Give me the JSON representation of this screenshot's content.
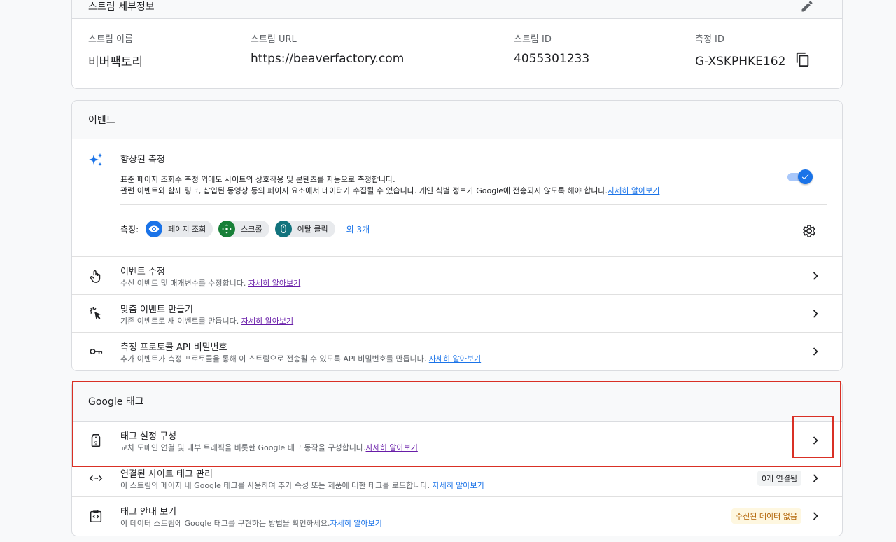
{
  "stream_card": {
    "header_title": "스트림 세부정보",
    "details": [
      {
        "label": "스트림 이름",
        "value": "비버팩토리"
      },
      {
        "label": "스트림 URL",
        "value": "https://beaverfactory.com"
      },
      {
        "label": "스트림 ID",
        "value": "4055301233"
      },
      {
        "label": "측정 ID",
        "value": "G-XSKPHKE162"
      }
    ]
  },
  "events_card": {
    "header_title": "이벤트",
    "enhanced": {
      "title": "향상된 측정",
      "desc_line1": "표준 페이지 조회수 측정 외에도 사이트의 상호작용 및 콘텐츠를 자동으로 측정합니다.",
      "desc_line2": "관련 이벤트와 함께 링크, 삽입된 동영상 등의 페이지 요소에서 데이터가 수집될 수 있습니다. 개인 식별 정보가 Google에 전송되지 않도록 해야 합니다.",
      "learn_more": "자세히 알아보기",
      "toggle_on": true,
      "measure_label": "측정:",
      "chips": [
        {
          "label": "페이지 조회",
          "icon": "eye-icon",
          "color": "#1a73e8"
        },
        {
          "label": "스크롤",
          "icon": "scroll-arrows-icon",
          "color": "#188038"
        },
        {
          "label": "이탈 클릭",
          "icon": "mouse-icon",
          "color": "#12737d"
        }
      ],
      "more": "외 3개"
    },
    "rows": [
      {
        "title": "이벤트 수정",
        "desc": "수신 이벤트 및 매개변수를 수정합니다.",
        "link": "자세히 알아보기",
        "icon": "touch-hand-icon"
      },
      {
        "title": "맞춤 이벤트 만들기",
        "desc": "기존 이벤트로 새 이벤트를 만듭니다.",
        "link": "자세히 알아보기",
        "icon": "cursor-click-icon"
      },
      {
        "title": "측정 프로토콜 API 비밀번호",
        "desc": "추가 이벤트가 측정 프로토콜을 통해 이 스트림으로 전송될 수 있도록 API 비밀번호를 만듭니다.",
        "link": "자세히 알아보기",
        "icon": "key-icon"
      }
    ]
  },
  "gtag_card": {
    "header_title": "Google 태그",
    "rows": [
      {
        "title": "태그 설정 구성",
        "desc": "교차 도메인 연결 및 내부 트래픽을 비롯한 Google 태그 동작을 구성합니다.",
        "link": "자세히 알아보기",
        "icon": "tag-icon",
        "badge": ""
      },
      {
        "title": "연결된 사이트 태그 관리",
        "desc": "이 스트림의 페이지 내 Google 태그를 사용하여 추가 속성 또는 제품에 대한 태그를 로드합니다.",
        "link": "자세히 알아보기",
        "icon": "code-arrows-icon",
        "badge": "0개 연결됨"
      },
      {
        "title": "태그 안내 보기",
        "desc": "이 데이터 스트림에 Google 태그를 구현하는 방법을 확인하세요.",
        "link": "자세히 알아보기",
        "icon": "code-clipboard-icon",
        "badge": "수신된 데이터 없음"
      }
    ]
  },
  "colors": {
    "accent": "#1a73e8",
    "highlight": "#d93025",
    "border": "#dadce0"
  }
}
